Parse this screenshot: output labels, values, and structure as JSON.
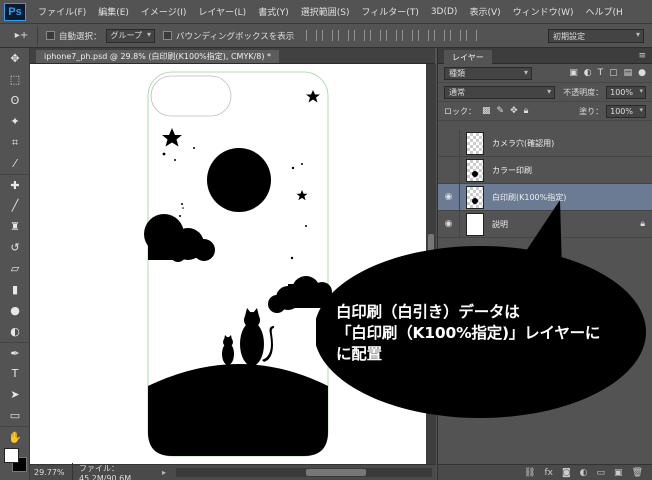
{
  "app": {
    "logo": "Ps"
  },
  "menu": [
    "ファイル(F)",
    "編集(E)",
    "イメージ(I)",
    "レイヤー(L)",
    "書式(Y)",
    "選択範囲(S)",
    "フィルター(T)",
    "3D(D)",
    "表示(V)",
    "ウィンドウ(W)",
    "ヘルプ(H"
  ],
  "options": {
    "auto_select_label": "自動選択：",
    "auto_select_value": "グループ",
    "bounding_box_label": "バウンディングボックスを表示",
    "mode_value": "初期設定"
  },
  "document": {
    "tab_label": "iphone7_ph.psd @ 29.8% (白印刷(K100%指定), CMYK/8) *",
    "zoom": "29.77%",
    "file_info": "ファイル：45.2M/90.6M"
  },
  "layers_panel": {
    "tab": "レイヤー",
    "filter_kind": "種類",
    "blend_mode": "通常",
    "opacity_label": "不透明度：",
    "opacity_value": "100%",
    "lock_label": "ロック：",
    "fill_label": "塗り：",
    "fill_value": "100%",
    "layers": [
      {
        "name": "カメラ穴(確認用)",
        "visible": false,
        "selected": false,
        "locked": false
      },
      {
        "name": "カラー印刷",
        "visible": false,
        "selected": false,
        "locked": false
      },
      {
        "name": "白印刷(K100%指定)",
        "visible": true,
        "selected": true,
        "locked": false
      },
      {
        "name": "説明",
        "visible": true,
        "selected": false,
        "locked": true
      }
    ]
  },
  "callout": {
    "line1": "白印刷（白引き）データは",
    "line2": "「白印刷（K100%指定)」レイヤーに",
    "line3": "に配置"
  },
  "icons": {
    "eye": "eye-icon",
    "lock": "lock-icon",
    "move_tool": "move-tool-icon"
  },
  "colors": {
    "ui_dark": "#535353",
    "selected_layer": "#6a7b93",
    "ps_blue": "#2e9fe8",
    "artwork": "#000000",
    "canvas": "#ffffff"
  }
}
